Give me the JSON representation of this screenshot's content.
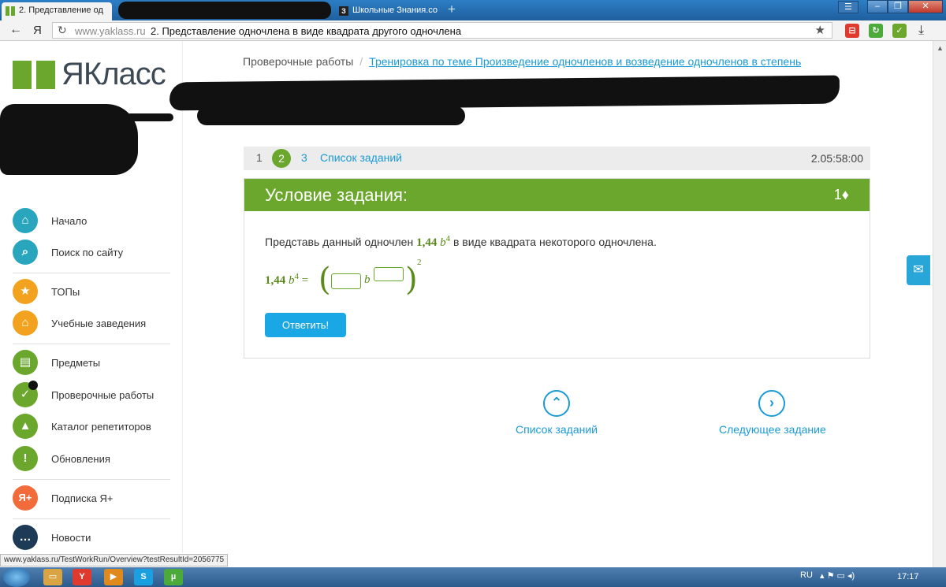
{
  "browser": {
    "tabs": [
      {
        "label": "2. Представление од"
      },
      {
        "label": "Школьные Знания.со"
      }
    ],
    "newtab": "+",
    "window_controls": {
      "menu": "☰",
      "min": "–",
      "max": "❐",
      "close": "✕"
    },
    "back": "←",
    "ya": "Я",
    "reload": "↻",
    "url_host": "www.yaklass.ru",
    "url_title": "2. Представление одночлена в виде квадрата другого одночлена",
    "star": "★",
    "download": "⤓"
  },
  "sidebar": {
    "logo": "ЯКласс",
    "items": [
      {
        "label": "Начало",
        "icon": "home-icon",
        "glyph": "⌂",
        "color": "#29a6bd"
      },
      {
        "label": "Поиск по сайту",
        "icon": "search-icon",
        "glyph": "⌕",
        "color": "#29a6bd"
      },
      {
        "label": "ТОПы",
        "icon": "star-icon",
        "glyph": "★",
        "color": "#f2a21e"
      },
      {
        "label": "Учебные заведения",
        "icon": "building-icon",
        "glyph": "⌂",
        "color": "#f2a21e"
      },
      {
        "label": "Предметы",
        "icon": "book-icon",
        "glyph": "▤",
        "color": "#6aa72c"
      },
      {
        "label": "Проверочные работы",
        "icon": "check-icon",
        "glyph": "✓",
        "color": "#6aa72c"
      },
      {
        "label": "Каталог репетиторов",
        "icon": "graduation-cap-icon",
        "glyph": "▲",
        "color": "#6aa72c"
      },
      {
        "label": "Обновления",
        "icon": "exclamation-icon",
        "glyph": "!",
        "color": "#6aa72c"
      },
      {
        "label": "Подписка Я+",
        "icon": "ya-plus-icon",
        "glyph": "Я+",
        "color": "#f26b3a"
      },
      {
        "label": "Новости",
        "icon": "chat-icon",
        "glyph": "…",
        "color": "#1d3b57"
      }
    ]
  },
  "breadcrumb": {
    "root": "Проверочные работы",
    "sep": "/",
    "current": "Тренировка по теме Произведение одночленов и возведение одночленов в степень"
  },
  "task_nav": {
    "numbers": [
      "1",
      "2",
      "3"
    ],
    "current_index": 1,
    "list_label": "Список заданий",
    "timer": "2.05:58:00"
  },
  "task": {
    "title": "Условие задания:",
    "points": "1♦",
    "text_before": "Представь данный одночлен ",
    "monomial_coef": "1,44",
    "monomial_var": "b",
    "monomial_exp": "4",
    "text_after": " в виде квадрата некоторого одночлена.",
    "eq_equals": "=",
    "eq_var": "b",
    "eq_outer_exp": "2",
    "paren_open": "(",
    "paren_close": ")",
    "answer_button": "Ответить!"
  },
  "bottom_nav": {
    "list_label": "Список заданий",
    "next_label": "Следующее задание",
    "up_glyph": "⌃",
    "next_glyph": "›"
  },
  "mail_glyph": "✉",
  "status_url": "www.yaklass.ru/TestWorkRun/Overview?testResultId=2056775",
  "windows": {
    "lang": "RU",
    "tray": "▴ ⚑ ▭ ◂)",
    "time": "17:17",
    "taskbar_icons": [
      {
        "name": "folder-icon",
        "glyph": "▭",
        "color": "#d9a441"
      },
      {
        "name": "yandex-browser-icon",
        "glyph": "Y",
        "color": "#e03a2e"
      },
      {
        "name": "media-player-icon",
        "glyph": "▶",
        "color": "#e08a1e"
      },
      {
        "name": "skype-icon",
        "glyph": "S",
        "color": "#1aa0e0"
      },
      {
        "name": "torrent-icon",
        "glyph": "µ",
        "color": "#4caa3a"
      }
    ]
  }
}
